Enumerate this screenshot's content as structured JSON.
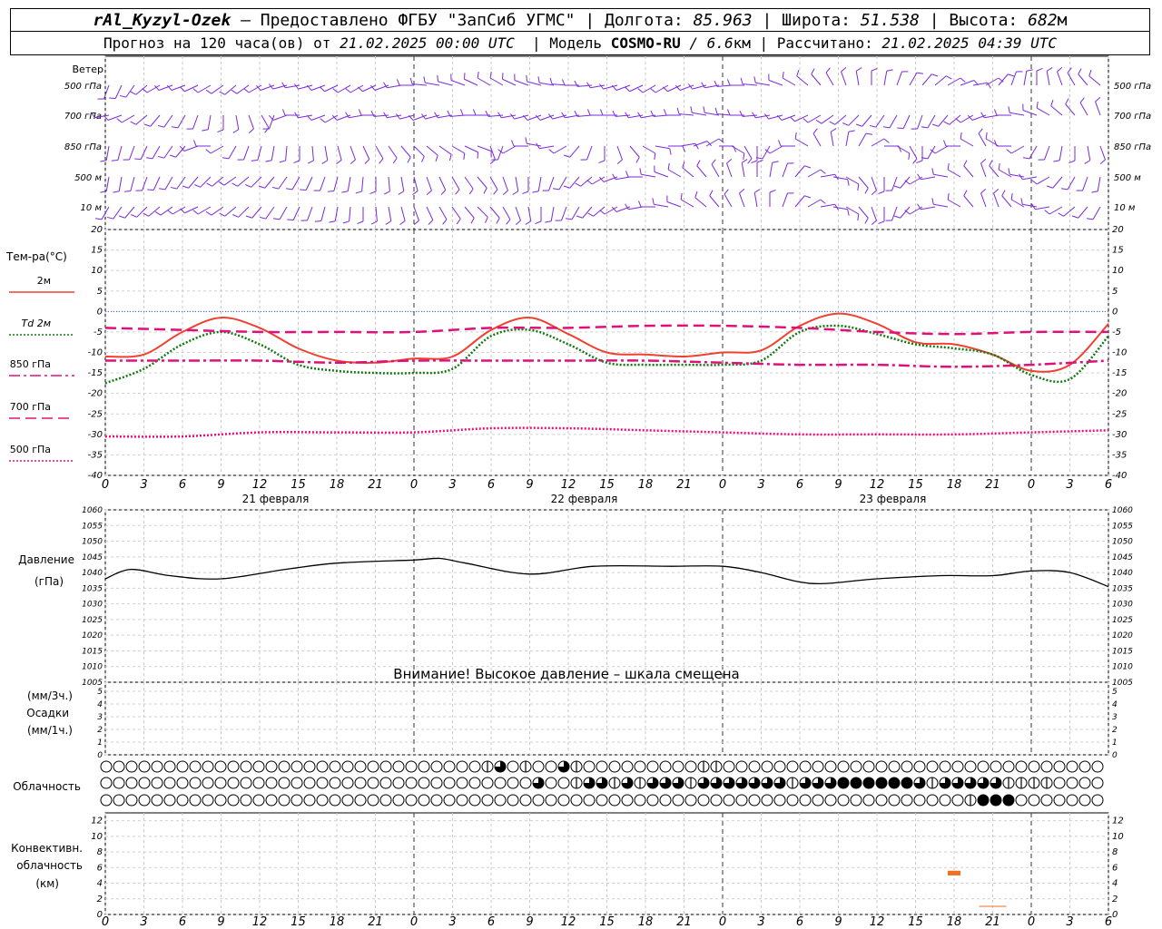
{
  "header": {
    "station": "rAl_Kyzyl-Ozek",
    "provider": "– Предоставлено ФГБУ \"ЗапСиб УГМС\"",
    "lon_label": "| Долгота:",
    "lon": "85.963",
    "lat_label": "| Широта:",
    "lat": "51.538",
    "alt_label": "| Высота:",
    "alt": "682",
    "alt_unit": "м",
    "forecast_label": "Прогноз на 120 часа(ов) от",
    "forecast_from": "21.02.2025 00:00 UTC",
    "model_label": "| Модель",
    "model": "COSMO-RU",
    "model_res": "/ 6.6",
    "model_unit": "км",
    "calc_label": "| Рассчитано:",
    "calc_time": "21.02.2025 04:39 UTC"
  },
  "wind_panel": {
    "title": "Ветер",
    "levels": [
      "500 гПа",
      "700 гПа",
      "850 гПа",
      "500 м",
      "10 м"
    ]
  },
  "temp_panel": {
    "title": "Тем-ра(°C)",
    "legend": [
      {
        "label": "2м",
        "color": "#f04030",
        "style": "solid"
      },
      {
        "label": "Td 2м",
        "color": "#107810",
        "style": "dotted"
      },
      {
        "label": "850 гПа",
        "color": "#e0107a",
        "style": "dashdot"
      },
      {
        "label": "700 гПа",
        "color": "#e0107a",
        "style": "dashed"
      },
      {
        "label": "500 гПа",
        "color": "#e0107a",
        "style": "dotted"
      }
    ]
  },
  "pressure_panel": {
    "title_1": "Давление",
    "title_2": "(гПа)",
    "warning": "Внимание! Высокое давление – шкала смещена"
  },
  "precip_panel": {
    "label_1": "(мм/3ч.)",
    "label_2": "Осадки",
    "label_3": "(мм/1ч.)"
  },
  "cloud_panel": {
    "title": "Облачность"
  },
  "conv_panel": {
    "title_1": "Конвективн.",
    "title_2": "облачность",
    "title_3": "(км)"
  },
  "time_axis": {
    "hour_labels": [
      "0",
      "3",
      "6",
      "9",
      "12",
      "15",
      "18",
      "21",
      "0",
      "3",
      "6",
      "9",
      "12",
      "15",
      "18",
      "21",
      "0",
      "3",
      "6",
      "9",
      "12",
      "15",
      "18",
      "21",
      "0",
      "3",
      "6"
    ],
    "dates": [
      "21 февраля",
      "22 февраля",
      "23 февраля"
    ]
  },
  "chart_data": [
    {
      "type": "line",
      "name": "temperature",
      "x_unit": "hours from 21.02.2025 00:00 UTC",
      "ylim": [
        -40,
        20
      ],
      "yticks": [
        20,
        15,
        10,
        5,
        0,
        -5,
        -10,
        -15,
        -20,
        -25,
        -30,
        -35,
        -40
      ],
      "series": [
        {
          "name": "2м",
          "color": "#f04030",
          "style": "solid",
          "x": [
            0,
            3,
            6,
            9,
            12,
            15,
            18,
            21,
            24,
            27,
            30,
            33,
            36,
            39,
            42,
            45,
            48,
            51,
            54,
            57,
            60,
            63,
            66,
            69,
            72,
            75,
            78
          ],
          "y": [
            -11,
            -10.5,
            -5,
            -1.5,
            -4,
            -9,
            -12,
            -12.5,
            -11.5,
            -11,
            -4.5,
            -1.5,
            -5.5,
            -10,
            -10.5,
            -11,
            -10,
            -9.5,
            -3.5,
            -0.5,
            -3,
            -7.5,
            -8,
            -10.5,
            -14.5,
            -13,
            -3
          ]
        },
        {
          "name": "Td 2м",
          "color": "#107810",
          "style": "dotted",
          "x": [
            0,
            3,
            6,
            9,
            12,
            15,
            18,
            21,
            24,
            27,
            30,
            33,
            36,
            39,
            42,
            45,
            48,
            51,
            54,
            57,
            60,
            63,
            66,
            69,
            72,
            75,
            78
          ],
          "y": [
            -17.5,
            -14,
            -8,
            -5,
            -8,
            -13,
            -14.5,
            -15,
            -15,
            -14,
            -6,
            -4.5,
            -8,
            -12.5,
            -13,
            -13,
            -13,
            -12,
            -5,
            -3.5,
            -5.5,
            -8,
            -9,
            -10.5,
            -15.5,
            -16.5,
            -6
          ]
        },
        {
          "name": "850 гПа",
          "color": "#e0107a",
          "style": "dashdot",
          "x": [
            0,
            6,
            12,
            18,
            24,
            30,
            36,
            42,
            48,
            54,
            60,
            66,
            72,
            78
          ],
          "y": [
            -12,
            -12,
            -12,
            -12.5,
            -12,
            -12,
            -12,
            -12,
            -12.5,
            -13,
            -13,
            -13.5,
            -13,
            -12
          ]
        },
        {
          "name": "700 гПа",
          "color": "#e0107a",
          "style": "dashed",
          "x": [
            0,
            6,
            12,
            18,
            24,
            30,
            36,
            42,
            48,
            54,
            60,
            66,
            72,
            78
          ],
          "y": [
            -4,
            -4.5,
            -5,
            -5,
            -5,
            -4,
            -4,
            -3.5,
            -3.5,
            -4,
            -5,
            -5.5,
            -5,
            -5
          ]
        },
        {
          "name": "500 гПа",
          "color": "#e0107a",
          "style": "dotted",
          "x": [
            0,
            6,
            12,
            18,
            24,
            30,
            36,
            42,
            48,
            54,
            60,
            66,
            72,
            78
          ],
          "y": [
            -30.5,
            -30.5,
            -29.5,
            -29.5,
            -29.5,
            -28.5,
            -28.5,
            -29,
            -29.5,
            -30,
            -30,
            -30,
            -29.5,
            -29
          ]
        }
      ]
    },
    {
      "type": "line",
      "name": "pressure",
      "ylim": [
        1005,
        1060
      ],
      "yticks": [
        1060,
        1055,
        1050,
        1045,
        1040,
        1035,
        1030,
        1025,
        1020,
        1015,
        1010,
        1005
      ],
      "series": [
        {
          "name": "pressure",
          "color": "#000000",
          "x": [
            0,
            2,
            5,
            9,
            14,
            18,
            24,
            26,
            28,
            33,
            38,
            44,
            48,
            51,
            55,
            60,
            65,
            69,
            72,
            75,
            78
          ],
          "y": [
            1038,
            1041,
            1039,
            1038,
            1041,
            1043,
            1044,
            1044.5,
            1043,
            1039.5,
            1042,
            1042,
            1042,
            1040,
            1036.5,
            1038,
            1039,
            1039,
            1040.5,
            1040,
            1035.5
          ]
        }
      ]
    },
    {
      "type": "bar",
      "name": "precipitation",
      "ylim": [
        0,
        5
      ],
      "yticks": [
        5,
        4,
        3,
        2,
        1,
        0
      ],
      "values": []
    },
    {
      "type": "table",
      "name": "cloudiness",
      "rows": [
        "upper",
        "middle",
        "lower"
      ],
      "symbols_per_row": 79,
      "upper": [
        0,
        0,
        0,
        0,
        0,
        0,
        0,
        0,
        0,
        0,
        0,
        0,
        0,
        0,
        0,
        0,
        0,
        0,
        0,
        0,
        0,
        0,
        0,
        0,
        0,
        0,
        0,
        0,
        0,
        0,
        2,
        3,
        0,
        2,
        0,
        0,
        3,
        2,
        0,
        0,
        0,
        0,
        0,
        0,
        0,
        0,
        0,
        2,
        2,
        0,
        0,
        0,
        0,
        0,
        0,
        0,
        0,
        0,
        0,
        0,
        0,
        0,
        0,
        0,
        0,
        0,
        0,
        0,
        0,
        0,
        0,
        0,
        0,
        0,
        0,
        0,
        0,
        0,
        0
      ],
      "middle": [
        0,
        0,
        0,
        0,
        0,
        0,
        0,
        0,
        0,
        0,
        0,
        0,
        0,
        0,
        0,
        0,
        0,
        0,
        0,
        0,
        0,
        0,
        0,
        0,
        0,
        0,
        0,
        0,
        0,
        0,
        0,
        0,
        0,
        0,
        3,
        0,
        0,
        2,
        3,
        3,
        2,
        3,
        2,
        3,
        3,
        3,
        2,
        3,
        3,
        3,
        3,
        3,
        3,
        3,
        2,
        3,
        3,
        3,
        4,
        4,
        4,
        4,
        4,
        4,
        3,
        2,
        3,
        3,
        3,
        3,
        3,
        2,
        2,
        2,
        2,
        0,
        0,
        0,
        0
      ],
      "lower": [
        0,
        0,
        0,
        0,
        0,
        0,
        0,
        0,
        0,
        0,
        0,
        0,
        0,
        0,
        0,
        0,
        0,
        0,
        0,
        0,
        0,
        0,
        0,
        0,
        0,
        0,
        0,
        0,
        0,
        0,
        0,
        0,
        0,
        0,
        0,
        0,
        0,
        0,
        0,
        0,
        0,
        0,
        0,
        0,
        0,
        0,
        0,
        0,
        0,
        0,
        0,
        0,
        0,
        0,
        0,
        0,
        0,
        0,
        0,
        0,
        0,
        0,
        0,
        0,
        0,
        0,
        0,
        0,
        2,
        4,
        4,
        4,
        0,
        0,
        0,
        0,
        0,
        0,
        0
      ]
    },
    {
      "type": "bar",
      "name": "convective cloudiness",
      "ylim": [
        0,
        13
      ],
      "yticks": [
        12,
        10,
        8,
        6,
        4,
        2,
        0
      ],
      "bars": [
        {
          "x": 66,
          "bottom": 5,
          "top": 5.6,
          "color": "#f07020"
        },
        {
          "x": 69,
          "bottom": 1,
          "top": 1.1,
          "color": "#f07020"
        }
      ]
    }
  ]
}
